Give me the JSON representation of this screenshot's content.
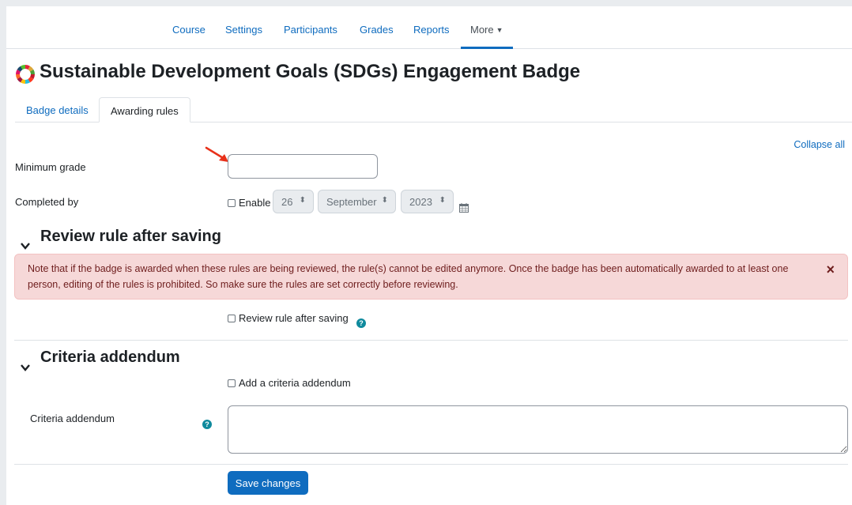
{
  "nav": {
    "items": [
      {
        "label": "Course"
      },
      {
        "label": "Settings"
      },
      {
        "label": "Participants"
      },
      {
        "label": "Grades"
      },
      {
        "label": "Reports"
      },
      {
        "label": "More"
      }
    ],
    "active": "More",
    "more_icon": "chevron-down-icon"
  },
  "page": {
    "title": "Sustainable Development Goals (SDGs) Engagement Badge",
    "title_icon": "sdg-wheel-icon"
  },
  "tabs": [
    {
      "label": "Badge details",
      "active": false
    },
    {
      "label": "Awarding rules",
      "active": true
    }
  ],
  "form": {
    "collapse_all": "Collapse all",
    "minimum_grade": {
      "label": "Minimum grade",
      "value": ""
    },
    "completed_by": {
      "label": "Completed by",
      "enable_label": "Enable",
      "enabled": false,
      "day": "26",
      "month": "September",
      "year": "2023",
      "calendar_icon": "calendar-icon"
    },
    "review_section": {
      "title": "Review rule after saving",
      "alert": "Note that if the badge is awarded when these rules are being reviewed, the rule(s) cannot be edited anymore. Once the badge has been automatically awarded to at least one person, editing of the rules is prohibited. So make sure the rules are set correctly before reviewing.",
      "alert_close": "×",
      "checkbox_label": "Review rule after saving",
      "checked": false
    },
    "criteria_section": {
      "title": "Criteria addendum",
      "checkbox_label": "Add a criteria addendum",
      "checked": false,
      "field_label": "Criteria addendum",
      "field_value": ""
    },
    "save_label": "Save changes",
    "help_glyph": "?"
  },
  "colors": {
    "link": "#0f6cbf",
    "alert_bg": "#f6d8d8",
    "alert_text": "#6e1d1d",
    "help_icon": "#0f8a9d",
    "annotation_arrow": "#e8311a"
  }
}
